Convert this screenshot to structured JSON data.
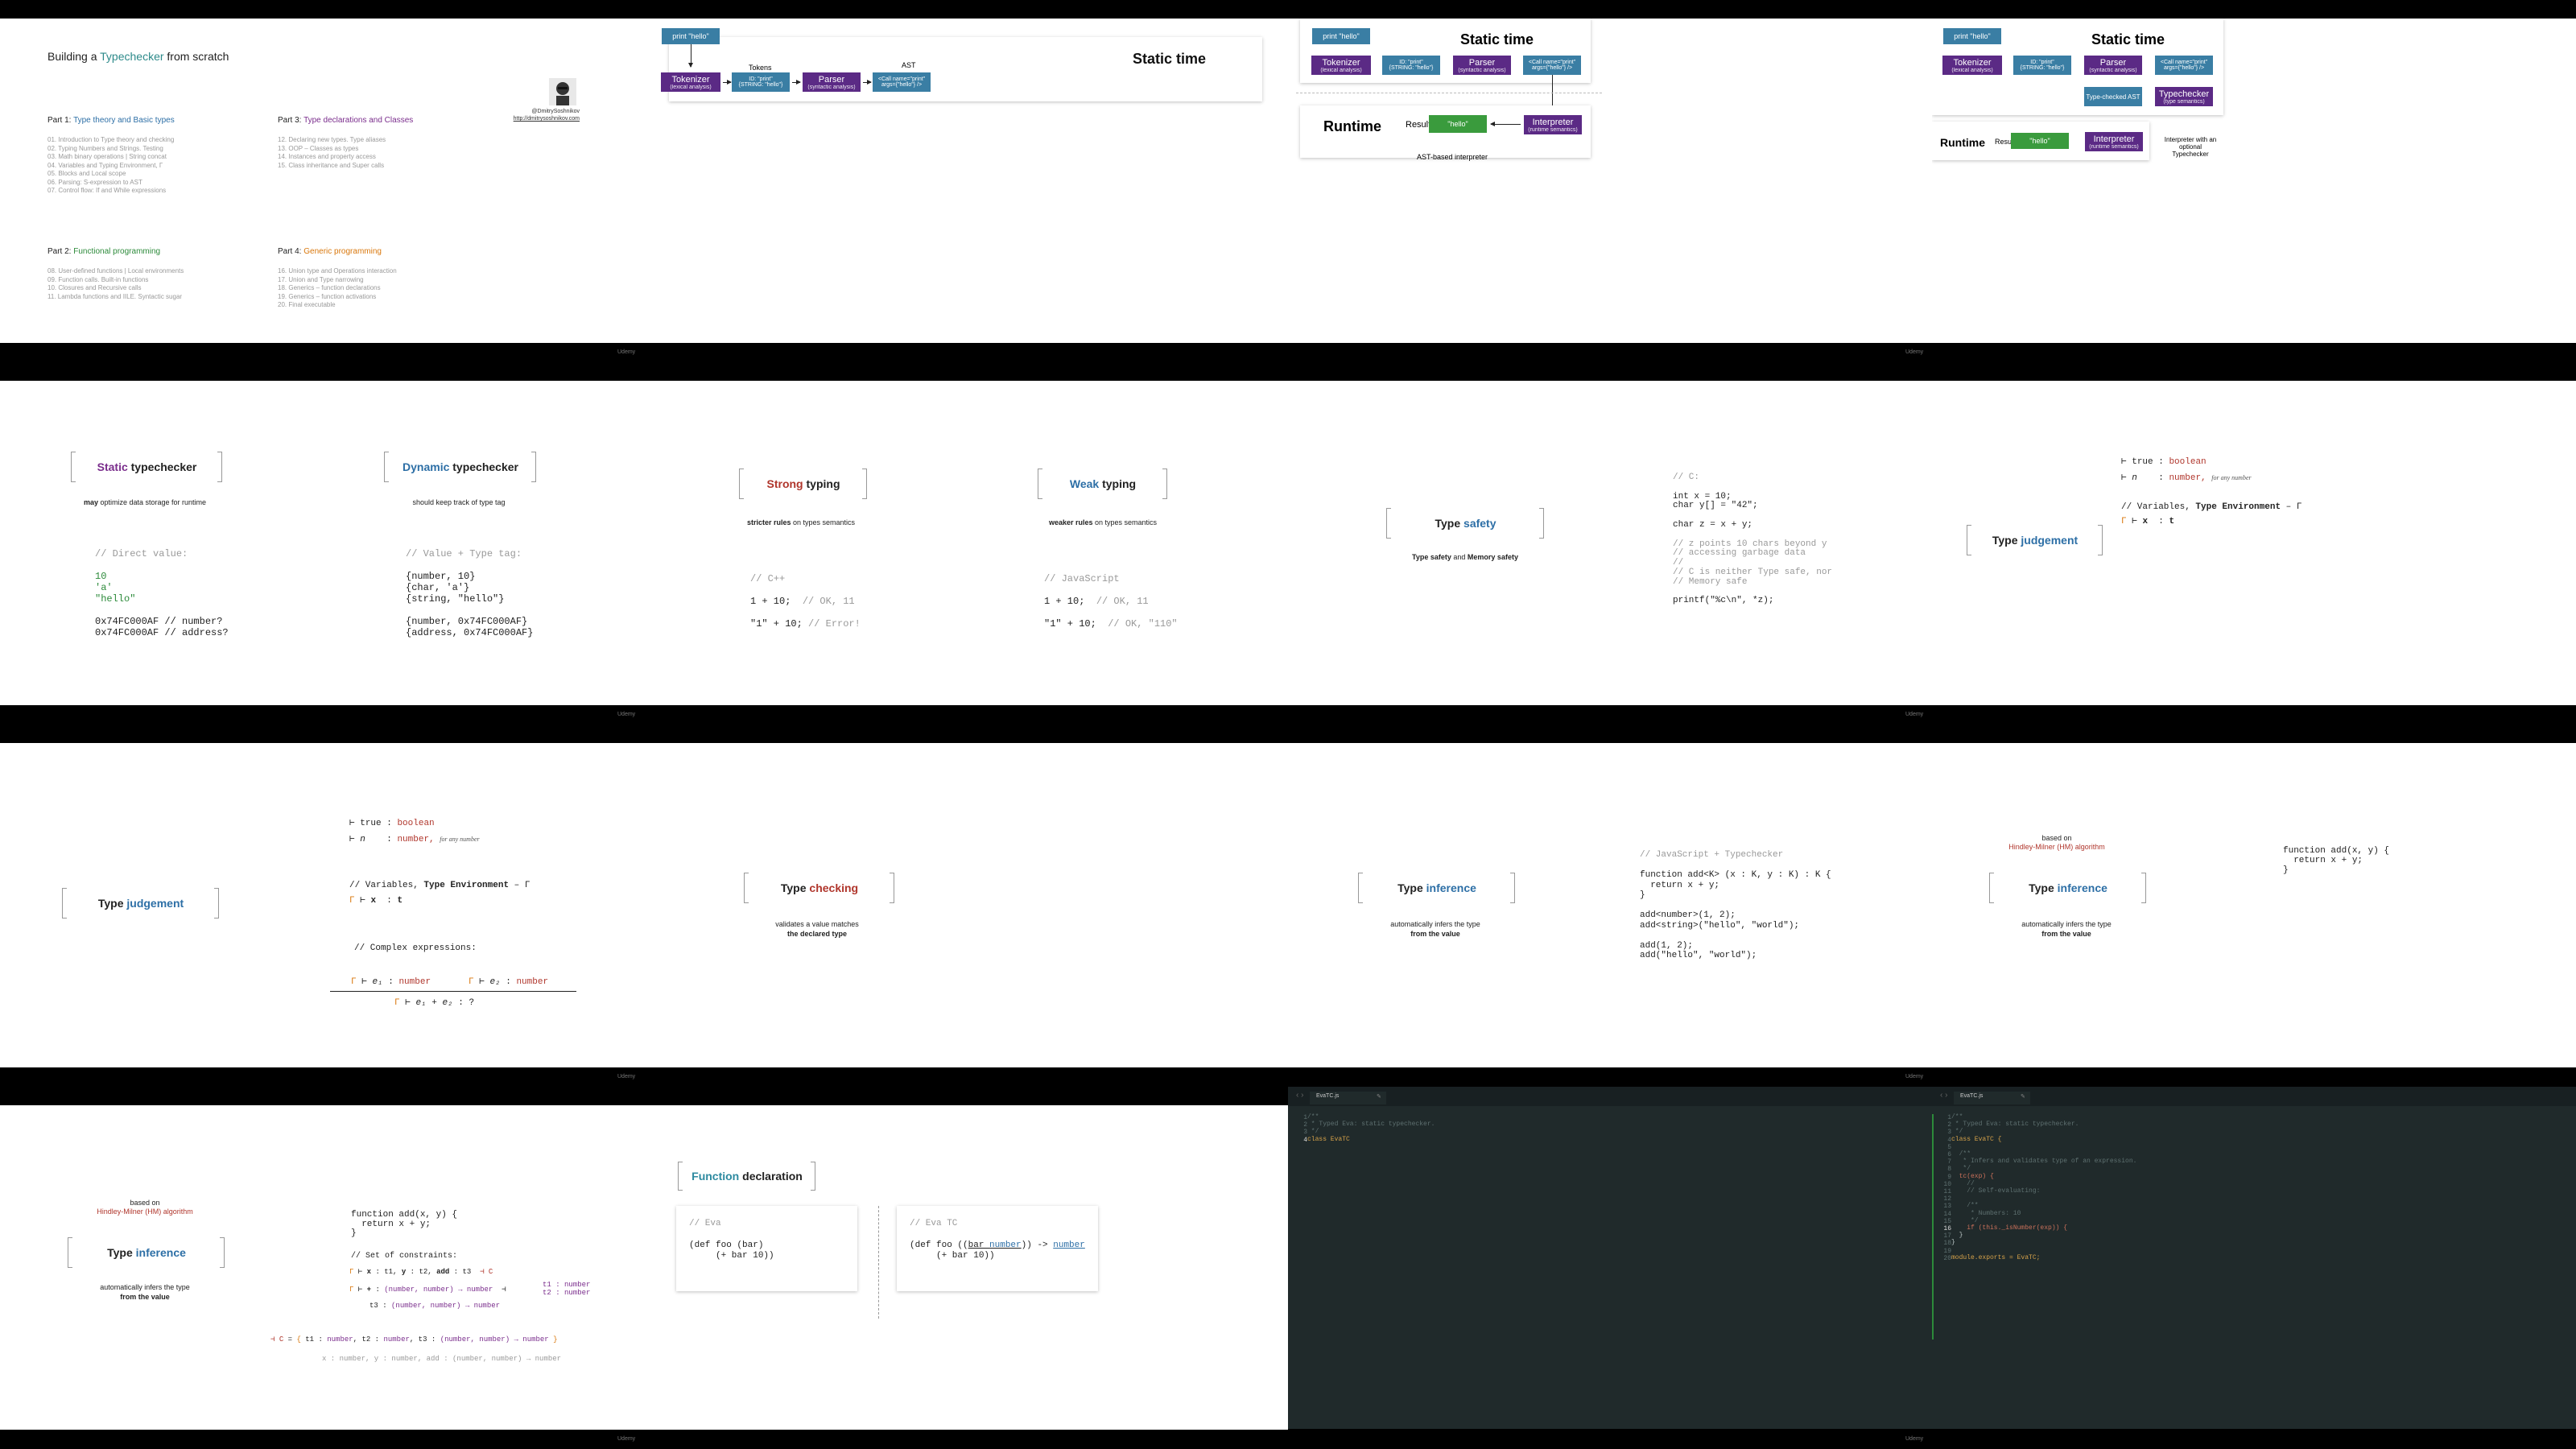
{
  "course": {
    "title_pre": "Building a ",
    "title_hl": "Typechecker",
    "title_post": " from scratch",
    "parts": [
      {
        "prefix": "Part 1: ",
        "name": "Type theory and Basic types",
        "color": "#2d6fa6",
        "lessons": [
          "01. Introduction to Type theory and checking",
          "02. Typing Numbers and Strings. Testing",
          "03. Math binary operations | String concat",
          "04. Variables and Typing Environment, Γ",
          "05. Blocks and Local scope",
          "06. Parsing: S-expression to AST",
          "07. Control flow: If and While expressions"
        ]
      },
      {
        "prefix": "Part 3: ",
        "name": "Type declarations and Classes",
        "color": "#7a2d8c",
        "lessons": [
          "12. Declaring new types. Type aliases",
          "13. OOP – Classes as types",
          "14. Instances and property access",
          "15. Class inheritance and Super calls"
        ]
      },
      {
        "prefix": "Part 2: ",
        "name": "Functional programming",
        "color": "#2c8a3a",
        "lessons": [
          "08. User-defined functions | Local environments",
          "09. Function calls. Built-in functions",
          "10. Closures and Recursive calls",
          "11. Lambda functions and IILE. Syntactic sugar"
        ]
      },
      {
        "prefix": "Part 4: ",
        "name": "Generic programming",
        "color": "#d9770c",
        "lessons": [
          "16. Union type and Operations interaction",
          "17. Union and Type narrowing",
          "18. Generics – function declarations",
          "19. Generics – function activations",
          "20. Final executable"
        ]
      }
    ],
    "author": "@DmitrySoshnikov",
    "author_url": "http://dmitrysoshnikov.com"
  },
  "footer_label": "Udemy",
  "pipeline": {
    "static_time": "Static time",
    "runtime": "Runtime",
    "print": "print \"hello\"",
    "tokens_label": "Tokens",
    "ast_label": "AST",
    "tokenizer": "Tokenizer",
    "tokenizer_sub": "(lexical analysis)",
    "tokens": "ID: \"print\"\n{STRING: \"hello\"}",
    "parser": "Parser",
    "parser_sub": "(syntactic analysis)",
    "ast": "<Call name=\"print\"\nargs={\"hello\"} />",
    "interpreter": "Interpreter",
    "interpreter_sub": "(runtime semantics)",
    "result_label": "Result",
    "result_value": "\"hello\"",
    "caption_ast": "AST-based interpreter",
    "typechecker": "Typechecker",
    "typechecker_sub": "(type semantics)",
    "checked_ast": "Type-checked AST",
    "caption_tc": "Interpreter with an optional Typechecker"
  },
  "concepts": {
    "static": {
      "kw": "Static",
      "rest": " typechecker",
      "desc_b": "may",
      "desc": " optimize data storage for runtime",
      "code": [
        "// Direct value:",
        "",
        "10",
        "'a'",
        "\"hello\"",
        "",
        "0x74FC000AF // number?",
        "0x74FC000AF // address?"
      ]
    },
    "dynamic": {
      "kw": "Dynamic",
      "rest": " typechecker",
      "desc": "should keep track of type tag",
      "code": [
        "// Value + Type tag:",
        "",
        "{number, 10}",
        "{char, 'a'}",
        "{string, \"hello\"}",
        "",
        "{number, 0x74FC000AF}",
        "{address, 0x74FC000AF}"
      ]
    },
    "strong": {
      "kw": "Strong",
      "rest": " typing",
      "desc_b": "stricter rules",
      "desc": " on types semantics",
      "code": [
        "// C++",
        "",
        "1 + 10;  // OK, 11",
        "",
        "\"1\" + 10; // Error!"
      ]
    },
    "weak": {
      "kw": "Weak",
      "rest": " typing",
      "desc_b": "weaker rules",
      "desc": " on types semantics",
      "code": [
        "// JavaScript",
        "",
        "1 + 10;  // OK, 11",
        "",
        "\"1\" + 10;  // OK, \"110\""
      ]
    },
    "safety": {
      "kw": "Type ",
      "rest": "safety",
      "desc_b1": "Type safety",
      "desc_mid": " and ",
      "desc_b2": "Memory safety",
      "code": [
        "// C:",
        "",
        "int x = 10;",
        "char y[] = \"42\";",
        "",
        "char z = x + y;",
        "",
        "// z points 10 chars beyond y",
        "// accessing garbage data",
        "//",
        "// C is neither Type safe, nor",
        "// Memory safe",
        "",
        "printf(\"%c\\n\", *z);"
      ]
    },
    "judgement": {
      "kw": "Type ",
      "rest": "judgement",
      "rules": [
        "⊢ true : boolean",
        "⊢ n    : number,",
        "for any number",
        "// Variables, Type Environment – Γ",
        "Γ ⊢ x  : t"
      ],
      "complex": "// Complex expressions:",
      "premise1": "Γ ⊢ e₁ : number",
      "premise2": "Γ ⊢ e₂ : number",
      "conclusion": "Γ ⊢ e₁ + e₂ : ?"
    },
    "checking": {
      "kw": "Type ",
      "rest": "checking",
      "desc": "validates a value matches",
      "desc2": "the declared type"
    },
    "inference": {
      "kw": "Type ",
      "rest": "inference",
      "desc": "automatically infers the type",
      "desc2": "from the value",
      "code": [
        "// JavaScript + Typechecker",
        "",
        "function add<K> (x : K, y : K) : K {",
        "  return x + y;",
        "}",
        "",
        "add<number>(1, 2);",
        "add<string>(\"hello\", \"world\");",
        "",
        "add(1, 2);",
        "add(\"hello\", \"world\");"
      ],
      "based_on": "based on",
      "hm": "Hindley-Milner (HM) algorithm",
      "func": [
        "function add(x, y) {",
        "  return x + y;",
        "}"
      ]
    },
    "constraints": {
      "comment": "// Set of constraints:",
      "c1": "Γ ⊢ x : t1, y : t2, add : t3  ⊣ C",
      "c2": "Γ ⊢ + : (number, number) → number  ⊣",
      "c2b": "t1 : number",
      "c2c": "t2 : number",
      "c3": "t3 : (number, number) → number",
      "c4": "⊣ C = { t1 : number, t2 : number, t3 : (number, number) → number }",
      "c5": "x : number, y : number, add : (number, number) → number"
    },
    "func_decl": {
      "kw": "Function",
      "rest": " declaration",
      "eva_label": "// Eva",
      "eva_code": [
        "(def foo (bar)",
        "     (+ bar 10))"
      ],
      "tc_label": "// Eva TC",
      "tc_code_1": "(def foo ((bar number)) -> number",
      "tc_code_2": "     (+ bar 10))"
    }
  },
  "editor": {
    "filename": "EvaTC.js",
    "left_lines": [
      "/**",
      " * Typed Eva: static typechecker.",
      " */",
      "class EvaTC"
    ],
    "right_lines": [
      "/**",
      " * Typed Eva: static typechecker.",
      " */",
      "class EvaTC {",
      "",
      "  /**",
      "   * Infers and validates type of an expression.",
      "   */",
      "  tc(exp) {",
      "    //",
      "    // Self-evaluating:",
      "",
      "    /**",
      "     * Numbers: 10",
      "     */",
      "    if (this._isNumber(exp)) {",
      "  }",
      "}",
      "",
      "module.exports = EvaTC;"
    ]
  },
  "colors": {
    "blue": "#3a7ea4",
    "purple": "#5b2a85",
    "green": "#3a9b3d",
    "editor_bg": "#202a2b",
    "accent_red": "#b0362c",
    "accent_orange": "#d9770c"
  }
}
